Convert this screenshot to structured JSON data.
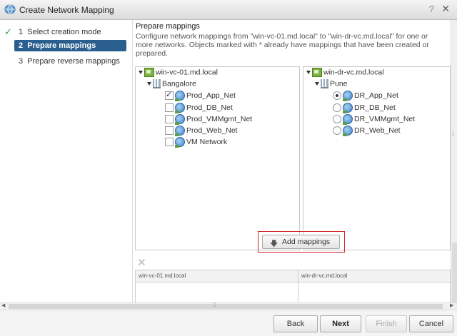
{
  "window": {
    "title": "Create Network Mapping",
    "help_glyph": "?",
    "close_glyph": "✕"
  },
  "steps": [
    {
      "number": "1",
      "label": "Select creation mode",
      "state": "done"
    },
    {
      "number": "2",
      "label": "Prepare mappings",
      "state": "active"
    },
    {
      "number": "3",
      "label": "Prepare reverse mappings",
      "state": "pending"
    }
  ],
  "main": {
    "heading": "Prepare mappings",
    "description": "Configure network mappings from \"win-vc-01.md.local\" to \"win-dr-vc.md.local\" for one or more networks. Objects marked with * already have mappings that have been created or prepared."
  },
  "left_tree": {
    "vcenter": "win-vc-01.md.local",
    "datacenter": "Bangalore",
    "networks": [
      {
        "name": "Prod_App_Net",
        "checked": true
      },
      {
        "name": "Prod_DB_Net",
        "checked": false
      },
      {
        "name": "Prod_VMMgmt_Net",
        "checked": false
      },
      {
        "name": "Prod_Web_Net",
        "checked": false
      },
      {
        "name": "VM Network",
        "checked": false
      }
    ]
  },
  "right_tree": {
    "vcenter": "win-dr-vc.md.local",
    "datacenter": "Pune",
    "networks": [
      {
        "name": "DR_App_Net",
        "selected": true
      },
      {
        "name": "DR_DB_Net",
        "selected": false
      },
      {
        "name": "DR_VMMgmt_Net",
        "selected": false
      },
      {
        "name": "DR_Web_Net",
        "selected": false
      }
    ]
  },
  "add_mappings_label": "Add mappings",
  "grid": {
    "columns": [
      "win-vc-01.md.local",
      "win-dr-vc.md.local"
    ]
  },
  "footer": {
    "back": "Back",
    "next": "Next",
    "finish": "Finish",
    "cancel": "Cancel"
  },
  "colors": {
    "active_step": "#2a5e8e",
    "highlight_border": "#d0272d",
    "check": "#3d9a3d"
  }
}
